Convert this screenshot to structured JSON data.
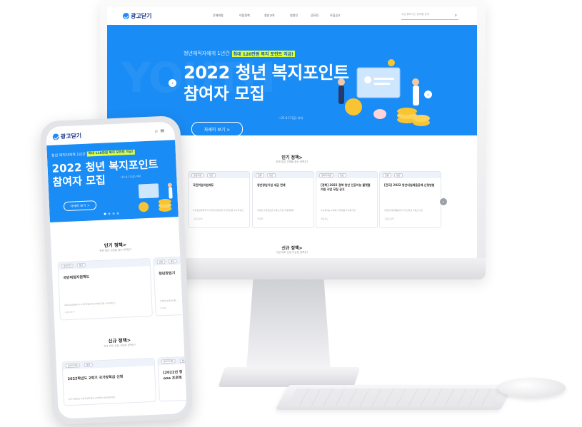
{
  "brand": {
    "logo_text": "광고닫기"
  },
  "desktop": {
    "nav": [
      "단체회원",
      "이점정책",
      "청년교육",
      "청원인",
      "공모전",
      "모집공고"
    ],
    "search_placeholder": "지금 원하시는 정보를 검색",
    "hero": {
      "sub_text": "청년재직자에게 1년간",
      "highlight": "최대 120만원 복지 포인트 지급!",
      "title_line1": "2022 청년 복지포인트",
      "title_line2": "참여자 모집",
      "date": "~22.6.17(금) 까지",
      "button": "자세히 보기 >"
    },
    "popular": {
      "title": "인기 정책>",
      "subtitle": "현재 많은 인원들 찾는 정책은?",
      "cards": [
        {
          "tags": [
            "일반지원",
            "청년"
          ],
          "title": "국민취업지원제도",
          "desc": "#취업성공패키지 #국민취업지원 #취업지원 #구직촉진",
          "footer": "고용노동부"
        },
        {
          "tags": [
            "금융",
            "청년"
          ],
          "title": "청년창업기업 세금 면제",
          "desc": "#창업 #세금감면 #중소기업 #세제혜택",
          "footer": "국세청"
        },
        {
          "tags": [
            "일자리지원",
            "청년"
          ],
          "title": "[경북] 2022 경북 청년 인공지능 플랫폼 지원 사업 모집 공고",
          "desc": "#인공지능 #경북 #플랫폼 #지원사업",
          "footer": "경상북도"
        },
        {
          "tags": [
            "금융",
            "청년"
          ],
          "title": "[전국] 2022 청년내일채움공제 신청방법",
          "desc": "#청년내일채움공제 #자산형성 #중소기업",
          "footer": "고용노동부"
        }
      ]
    },
    "new_policies": {
      "title": "신규 정책>",
      "subtitle": "지금 바로 신청 가능한 정책은?"
    }
  },
  "phone": {
    "hero": {
      "sub_text": "청년 재직자에게 1년간",
      "highlight": "최대 120만원 복지 포인트 지급!",
      "title_line1": "2022 청년 복지포인트",
      "title_line2": "참여자 모집",
      "date": "~22.6.17(금) 까지",
      "button": "자세히 보기 >"
    },
    "popular": {
      "title": "인기 정책>",
      "subtitle": "현재 많은 인원들 찾는 정책은?",
      "card1": {
        "tags": [
          "일자리지",
          "청년"
        ],
        "title": "국민취업지원제도",
        "desc": "#취업성공패키지 #국민취업지원 #취업지원 #구직촉진...",
        "footer": "고용노동부"
      },
      "card2": {
        "tags": [
          "금융",
          "청년"
        ],
        "title": "청년창업기",
        "desc": "#창업 #세금감면 ...",
        "footer": "국세청"
      }
    },
    "new_policies": {
      "title": "신규 정책>",
      "subtitle": "지금 바로 신청 가능한 정책은?",
      "card1": {
        "tags": [
          "일자리지원",
          "청년"
        ],
        "title": "2022학년도 2학기 국가장학금 신청",
        "footer": "#국가장학금 #한국장학재단 #대학생 #등록금지원"
      },
      "card2": {
        "tags": [
          "일자리지원",
          "청년"
        ],
        "title_line1": "[2022년 청",
        "title_line2": "one 프로젝"
      }
    }
  },
  "colors": {
    "hero_blue": "#1a8cf5",
    "highlight": "#dfff3a",
    "brand_navy": "#1e3a8a"
  }
}
